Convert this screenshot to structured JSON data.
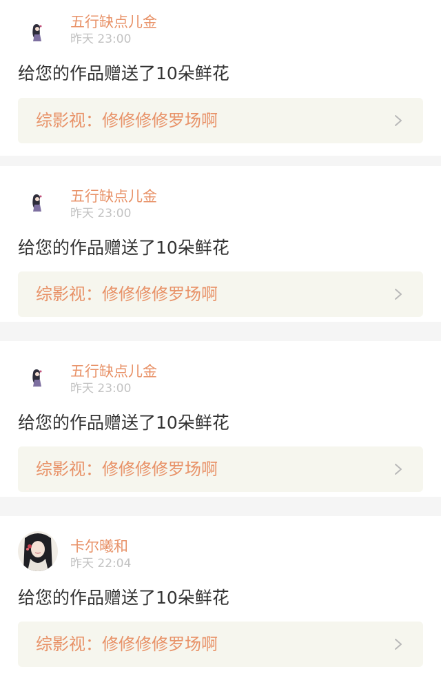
{
  "notifications": [
    {
      "username": "五行缺点儿金",
      "time": "昨天 23:00",
      "message": "给您的作品赠送了10朵鲜花",
      "work_title": "综影视：修修修修罗场啊",
      "avatar_icon": "avatar-small-figure-icon"
    },
    {
      "username": "五行缺点儿金",
      "time": "昨天 23:00",
      "message": "给您的作品赠送了10朵鲜花",
      "work_title": "综影视：修修修修罗场啊",
      "avatar_icon": "avatar-small-figure-icon"
    },
    {
      "username": "五行缺点儿金",
      "time": "昨天 23:00",
      "message": "给您的作品赠送了10朵鲜花",
      "work_title": "综影视：修修修修罗场啊",
      "avatar_icon": "avatar-small-figure-icon"
    },
    {
      "username": "卡尔曦和",
      "time": "昨天 22:04",
      "message": "给您的作品赠送了10朵鲜花",
      "work_title": "综影视：修修修修罗场啊",
      "avatar_icon": "avatar-portrait-icon"
    }
  ],
  "colors": {
    "accent": "#e89268",
    "timestamp": "#c2c2c2",
    "message": "#333333",
    "link_bg": "#f6f6ee",
    "separator": "#f5f5f5",
    "tab_indicator": "#e38ab0"
  }
}
